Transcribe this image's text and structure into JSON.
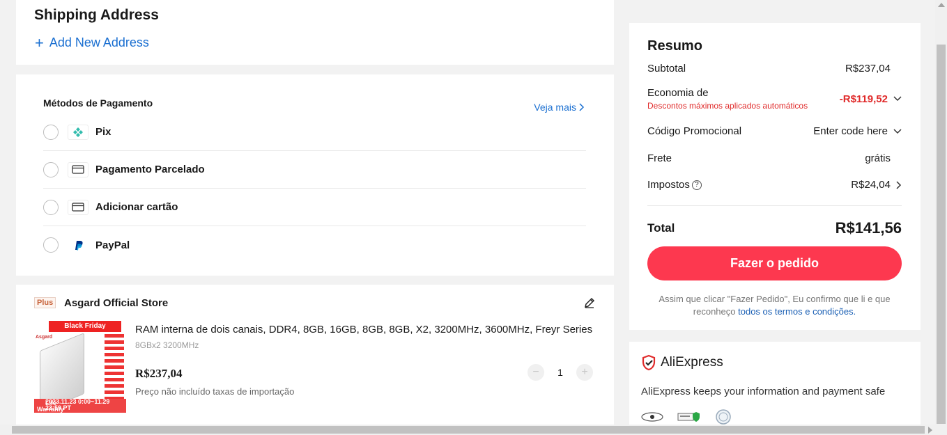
{
  "shipping": {
    "title": "Shipping Address",
    "add_label": "Add New Address"
  },
  "payment": {
    "title": "Métodos de Pagamento",
    "more_label": "Veja mais",
    "methods": [
      {
        "label": "Pix",
        "icon": "pix-icon"
      },
      {
        "label": "Pagamento Parcelado",
        "icon": "card-icon"
      },
      {
        "label": "Adicionar cartão",
        "icon": "card-icon"
      },
      {
        "label": "PayPal",
        "icon": "paypal-icon"
      }
    ]
  },
  "store": {
    "badge": "Plus",
    "name": "Asgard Official Store",
    "product": {
      "image_badge": "Black Friday",
      "image_brand": "Asgard",
      "image_warranty_line1": "Life",
      "image_warranty_line2": "Warranty",
      "image_date": "2023.11.23 0:00~11.29 23:59 PT",
      "title": "RAM interna de dois canais, DDR4, 8GB, 16GB, 8GB, 8GB, X2, 3200MHz, 3600MHz, Freyr Series",
      "variant": "8GBx2 3200MHz",
      "price": "R$237,04",
      "note": "Preço não incluído taxas de importação",
      "quantity": "1"
    }
  },
  "summary": {
    "title": "Resumo",
    "subtotal_label": "Subtotal",
    "subtotal_value": "R$237,04",
    "savings_label": "Economia de",
    "savings_sub": "Descontos máximos aplicados automáticos",
    "savings_value": "-R$119,52",
    "promo_label": "Código Promocional",
    "promo_value": "Enter code here",
    "shipping_label": "Frete",
    "shipping_value": "grátis",
    "tax_label": "Impostos",
    "tax_value": "R$24,04",
    "total_label": "Total",
    "total_value": "R$141,56",
    "order_button": "Fazer o pedido",
    "terms_text": "Assim que clicar \"Fazer Pedido\", Eu confirmo que li e que reconheço",
    "terms_link": "todos os termos e condições."
  },
  "trust": {
    "brand": "AliExpress",
    "safe_text": "AliExpress keeps your information and payment safe"
  },
  "colors": {
    "accent": "#fd384f",
    "link": "#1a6fd1",
    "discount": "#e02b2b"
  }
}
